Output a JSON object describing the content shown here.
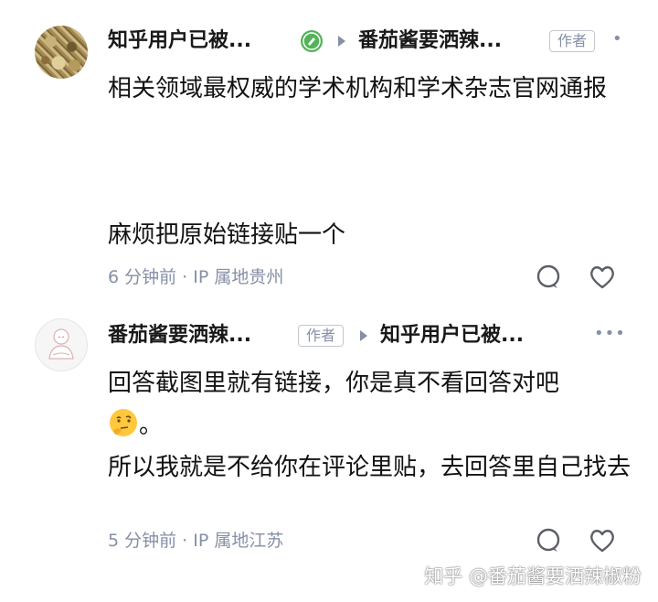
{
  "comments": [
    {
      "author": "知乎用户已被...",
      "reply_to": "番茄酱要洒辣...",
      "reply_to_badge": "作者",
      "text_lines": [
        "相关领域最权威的学术机构和学术杂志官网通报"
      ],
      "text_lines_2": [
        "麻烦把原始链接贴一个"
      ],
      "meta": "6 分钟前 · IP 属地贵州"
    },
    {
      "author": "番茄酱要洒辣...",
      "author_badge": "作者",
      "reply_to": "知乎用户已被...",
      "text_line_1": "回答截图里就有链接，你是真不看回答对吧",
      "text_line_1_tail": "。",
      "text_line_2": "所以我就是不给你在评论里贴，去回答里自己找去",
      "meta": "5 分钟前 · IP 属地江苏"
    }
  ],
  "watermark": "知乎 @番茄酱要洒辣椒粉",
  "colors": {
    "meta": "#8590a6",
    "text": "#121212",
    "badge_green": "#52b35a"
  },
  "icons": [
    "comment-icon",
    "like-icon",
    "more-icon",
    "reply-arrow-icon",
    "verified-badge-icon",
    "thinking-emoji"
  ]
}
